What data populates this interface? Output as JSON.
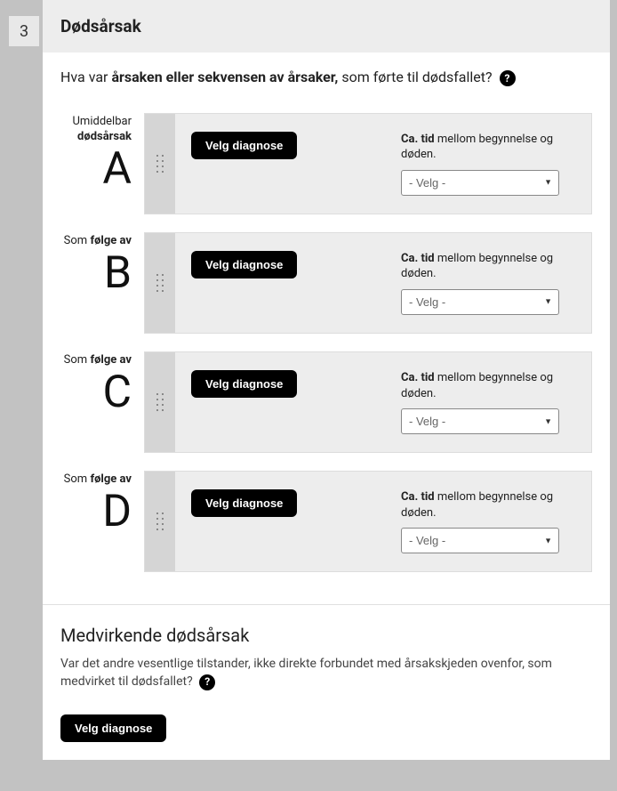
{
  "step_number": "3",
  "header_title": "Dødsårsak",
  "question": {
    "prefix": "Hva var ",
    "bold_part": "årsaken eller sekvensen av årsaker,",
    "suffix": " som førte til dødsfallet?"
  },
  "button_label": "Velg diagnose",
  "time_label": {
    "bold": "Ca. tid",
    "rest": " mellom begynnelse og døden."
  },
  "select_placeholder": "- Velg -",
  "rows": [
    {
      "label_prefix": "Umiddelbar",
      "label_bold": "dødsårsak",
      "letter": "A"
    },
    {
      "label_prefix": "Som ",
      "label_bold": "følge av",
      "letter": "B"
    },
    {
      "label_prefix": "Som ",
      "label_bold": "følge av",
      "letter": "C"
    },
    {
      "label_prefix": "Som ",
      "label_bold": "følge av",
      "letter": "D"
    }
  ],
  "contributing": {
    "title": "Medvirkende dødsårsak",
    "desc": "Var det andre vesentlige tilstander, ikke direkte forbundet med årsakskjeden ovenfor, som medvirket til dødsfallet?"
  }
}
